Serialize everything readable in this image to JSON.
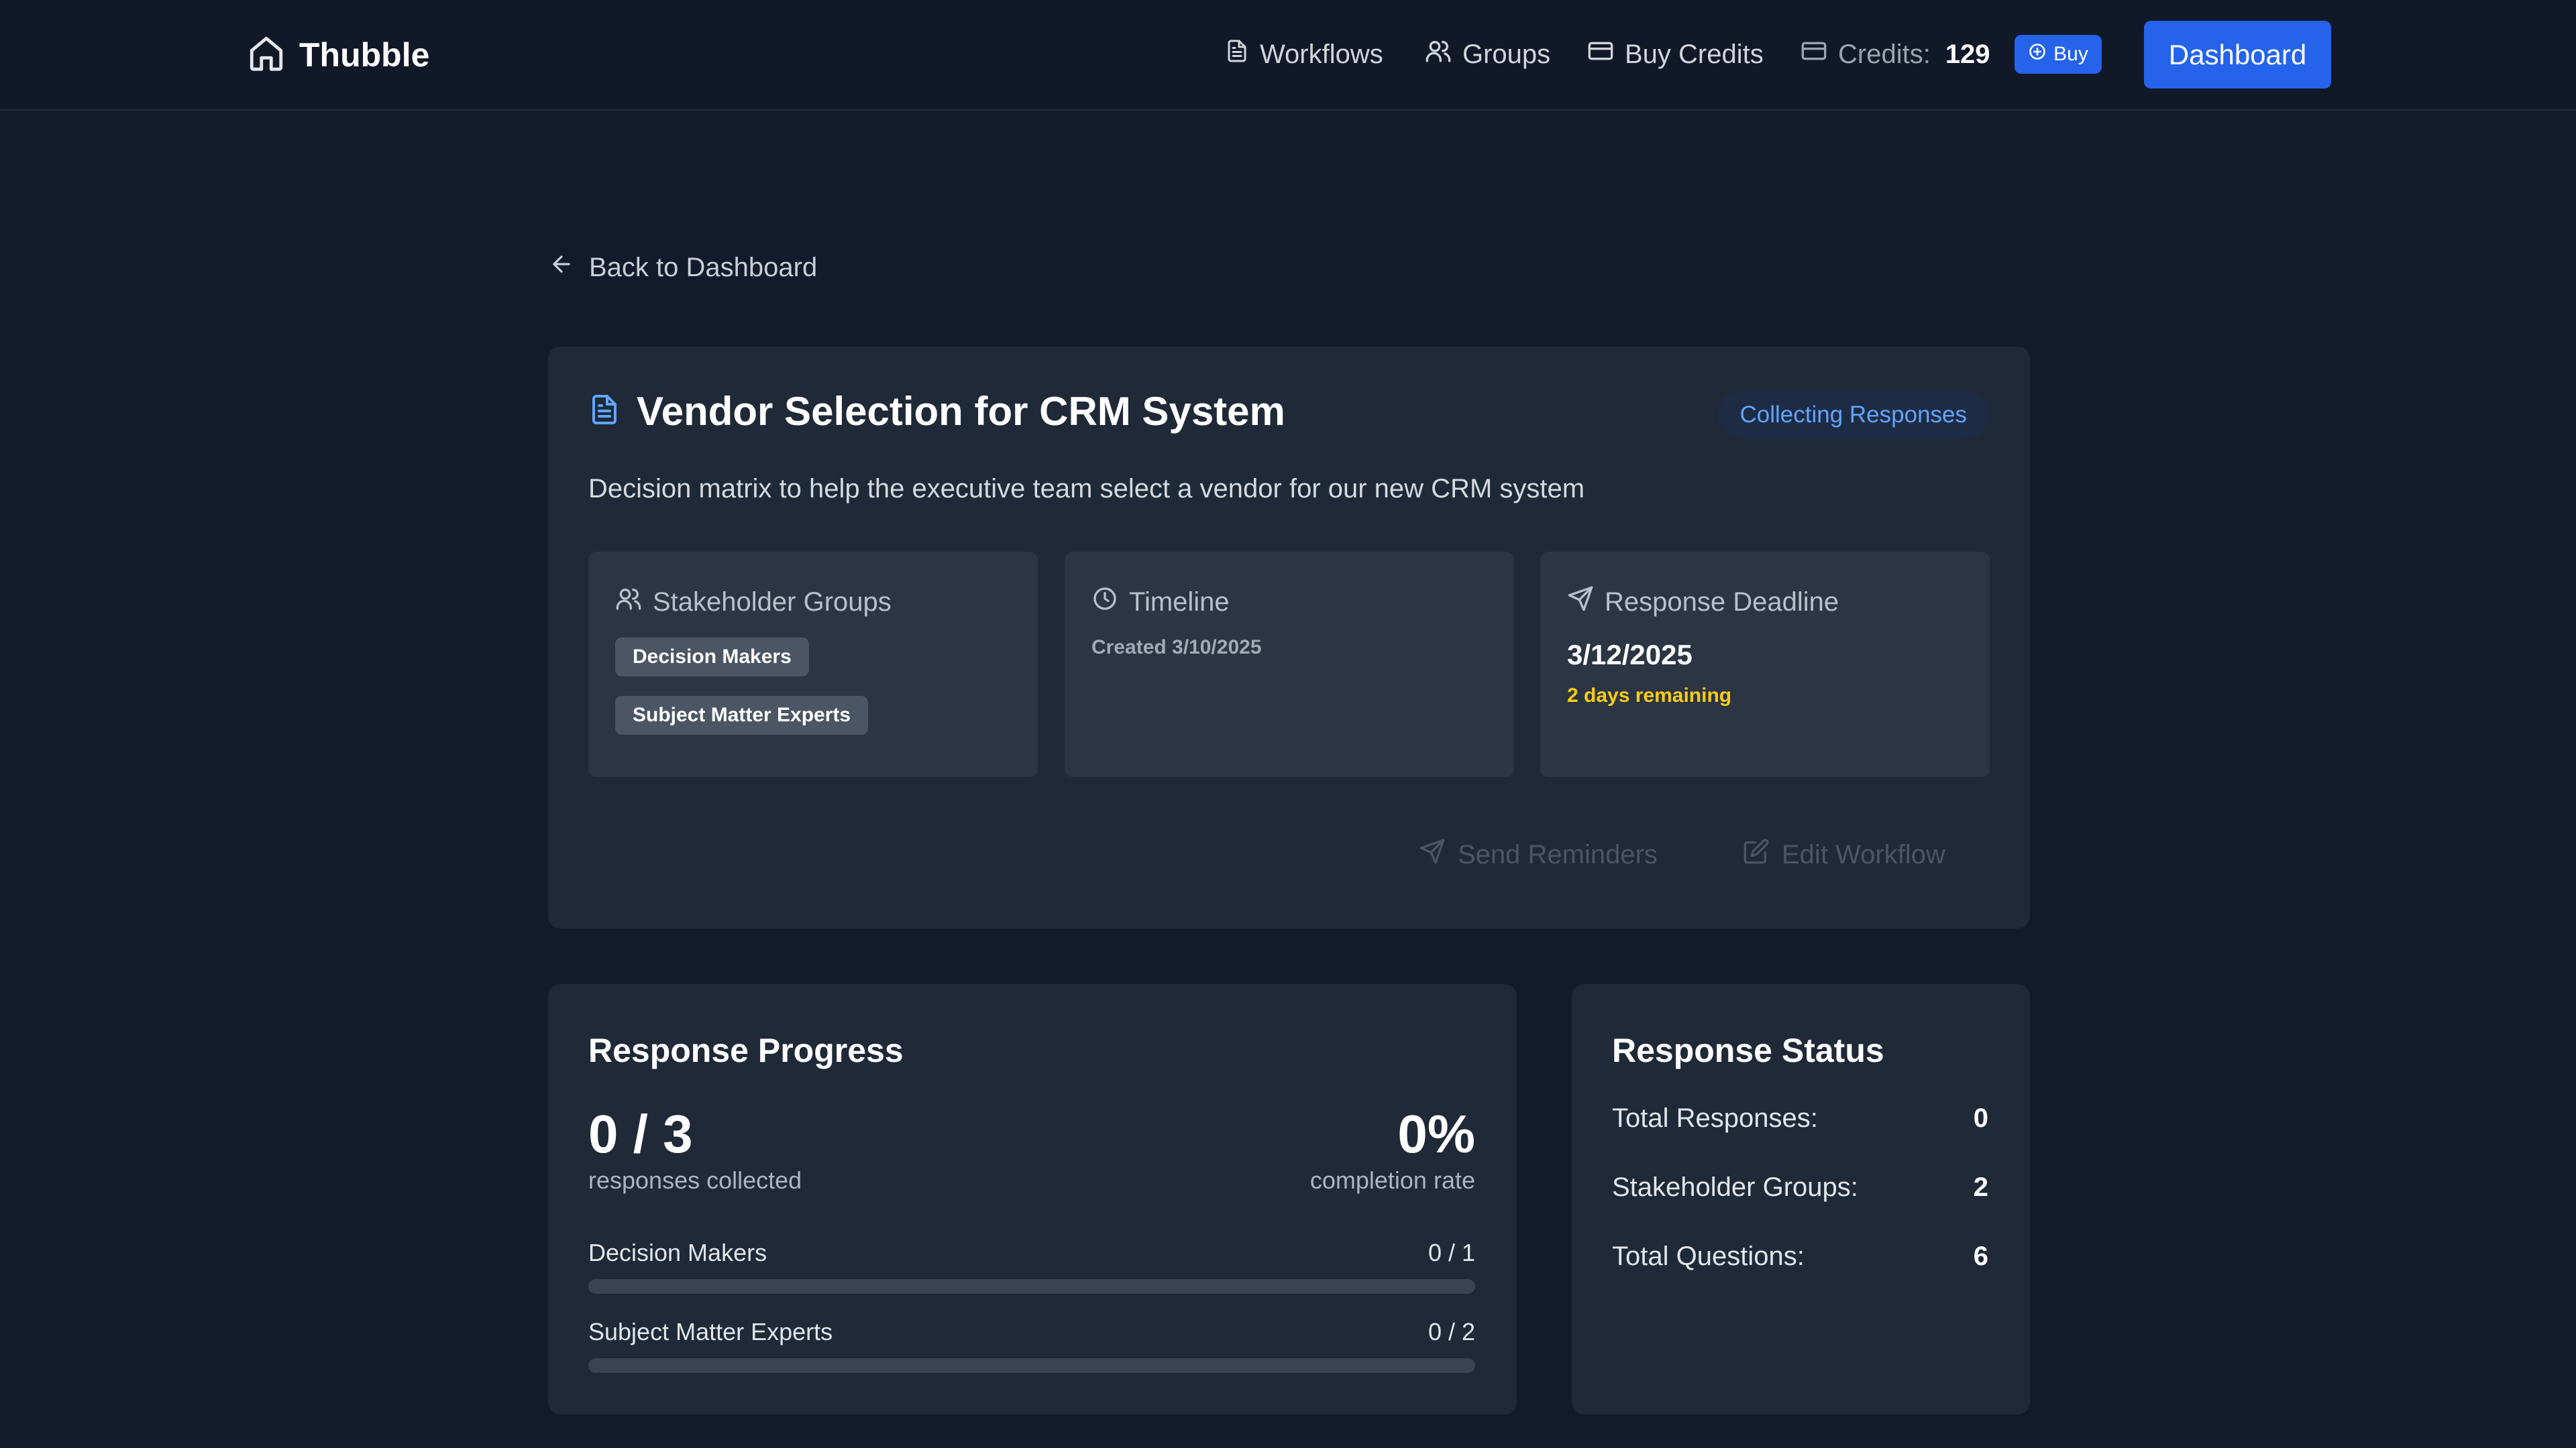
{
  "brand": {
    "name": "Thubble"
  },
  "nav": {
    "workflows": "Workflows",
    "groups": "Groups",
    "buy_credits": "Buy Credits",
    "credits_label": "Credits:",
    "credits_value": "129",
    "buy": "Buy",
    "dashboard": "Dashboard"
  },
  "back_link": "Back to Dashboard",
  "workflow": {
    "title": "Vendor Selection for CRM System",
    "status": "Collecting Responses",
    "description": "Decision matrix to help the executive team select a vendor for our new CRM system",
    "stakeholder_heading": "Stakeholder Groups",
    "groups": [
      "Decision Makers",
      "Subject Matter Experts"
    ],
    "timeline_heading": "Timeline",
    "created": "Created 3/10/2025",
    "deadline_heading": "Response Deadline",
    "deadline_date": "3/12/2025",
    "deadline_remaining": "2 days remaining",
    "send_reminders": "Send Reminders",
    "edit_workflow": "Edit Workflow"
  },
  "progress": {
    "title": "Response Progress",
    "collected": "0 / 3",
    "collected_label": "responses collected",
    "rate": "0%",
    "rate_label": "completion rate",
    "groups": [
      {
        "name": "Decision Makers",
        "count": "0 / 1",
        "fraction": 0
      },
      {
        "name": "Subject Matter Experts",
        "count": "0 / 2",
        "fraction": 0
      }
    ]
  },
  "status": {
    "title": "Response Status",
    "rows": [
      {
        "label": "Total Responses:",
        "value": "0"
      },
      {
        "label": "Stakeholder Groups:",
        "value": "2"
      },
      {
        "label": "Total Questions:",
        "value": "6"
      }
    ]
  },
  "colors": {
    "accent": "#2563eb",
    "status_badge_text": "#60a5fa",
    "warning": "#facc15",
    "background": "#121a2c",
    "card": "#1f2937"
  }
}
